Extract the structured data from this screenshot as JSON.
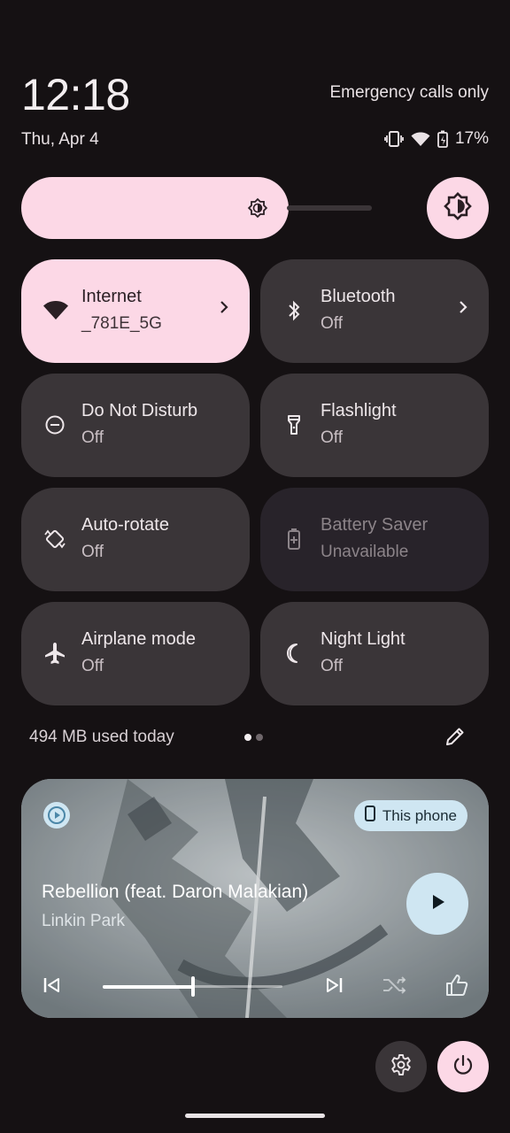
{
  "header": {
    "time": "12:18",
    "date": "Thu, Apr 4",
    "carrier": "Emergency calls only",
    "battery_percent": "17%"
  },
  "brightness": {
    "level": 0.74
  },
  "tiles": [
    {
      "label": "Internet",
      "sub": "_781E_5G",
      "icon": "wifi-icon",
      "state": "active"
    },
    {
      "label": "Bluetooth",
      "sub": "Off",
      "icon": "bluetooth-icon",
      "state": "off"
    },
    {
      "label": "Do Not Disturb",
      "sub": "Off",
      "icon": "do-not-disturb-icon",
      "state": "off"
    },
    {
      "label": "Flashlight",
      "sub": "Off",
      "icon": "flashlight-icon",
      "state": "off"
    },
    {
      "label": "Auto-rotate",
      "sub": "Off",
      "icon": "auto-rotate-icon",
      "state": "off"
    },
    {
      "label": "Battery Saver",
      "sub": "Unavailable",
      "icon": "battery-saver-icon",
      "state": "disabled"
    },
    {
      "label": "Airplane mode",
      "sub": "Off",
      "icon": "airplane-icon",
      "state": "off"
    },
    {
      "label": "Night Light",
      "sub": "Off",
      "icon": "night-light-icon",
      "state": "off"
    }
  ],
  "footer": {
    "data_used": "494 MB used today",
    "page_count": 2,
    "current_page": 1
  },
  "media": {
    "title": "Rebellion (feat. Daron Malakian)",
    "artist": "Linkin Park",
    "output_device": "This phone",
    "progress": 0.5
  },
  "colors": {
    "background": "#151113",
    "accent": "#fcd8e6",
    "tile": "#3a3538",
    "media_accent": "#cfe6f2"
  }
}
